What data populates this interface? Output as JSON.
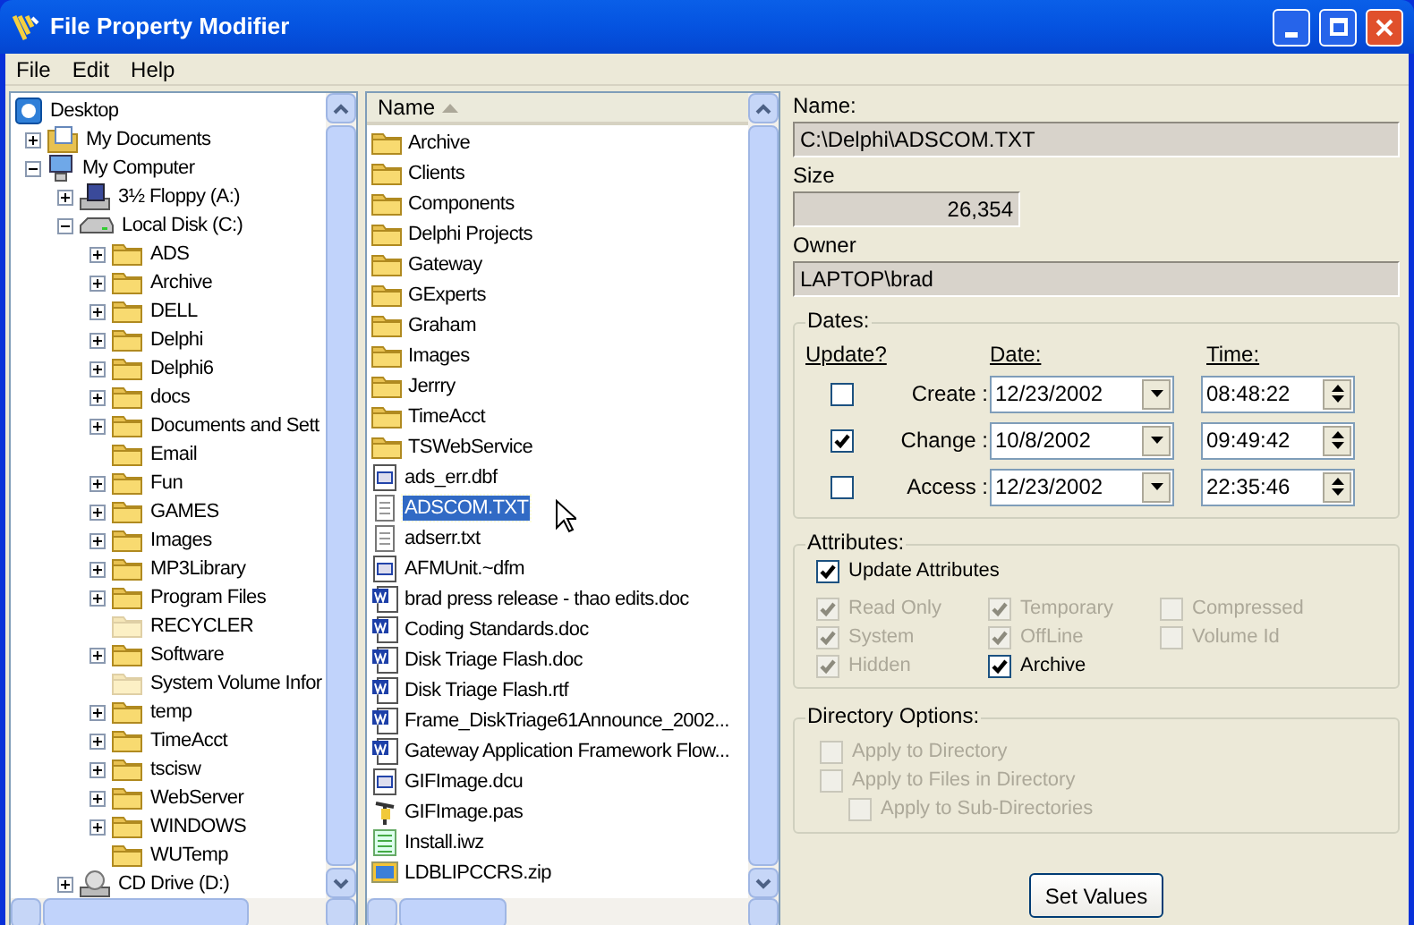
{
  "window": {
    "title": "File Property Modifier"
  },
  "menu": [
    "File",
    "Edit",
    "Help"
  ],
  "tree": [
    {
      "label": "Desktop",
      "kind": "desktop",
      "children": [
        {
          "label": "My Documents",
          "kind": "documents",
          "expanded": false
        },
        {
          "label": "My Computer",
          "kind": "computer",
          "expanded": true,
          "children": [
            {
              "label": "3½ Floppy (A:)",
              "kind": "floppy",
              "expanded": false
            },
            {
              "label": "Local Disk (C:)",
              "kind": "disk",
              "expanded": true,
              "children": [
                {
                  "label": "ADS",
                  "kind": "folder",
                  "expanded": false
                },
                {
                  "label": "Archive",
                  "kind": "folder",
                  "expanded": false
                },
                {
                  "label": "DELL",
                  "kind": "folder",
                  "expanded": false
                },
                {
                  "label": "Delphi",
                  "kind": "folder",
                  "expanded": false
                },
                {
                  "label": "Delphi6",
                  "kind": "folder",
                  "expanded": false
                },
                {
                  "label": "docs",
                  "kind": "folder",
                  "expanded": false
                },
                {
                  "label": "Documents and Sett",
                  "kind": "folder",
                  "expanded": false
                },
                {
                  "label": "Email",
                  "kind": "folder"
                },
                {
                  "label": "Fun",
                  "kind": "folder",
                  "expanded": false
                },
                {
                  "label": "GAMES",
                  "kind": "folder",
                  "expanded": false
                },
                {
                  "label": "Images",
                  "kind": "folder",
                  "expanded": false
                },
                {
                  "label": "MP3Library",
                  "kind": "folder",
                  "expanded": false
                },
                {
                  "label": "Program Files",
                  "kind": "folder",
                  "expanded": false
                },
                {
                  "label": "RECYCLER",
                  "kind": "hidden-folder"
                },
                {
                  "label": "Software",
                  "kind": "folder",
                  "expanded": false
                },
                {
                  "label": "System Volume Infor",
                  "kind": "hidden-folder"
                },
                {
                  "label": "temp",
                  "kind": "folder",
                  "expanded": false
                },
                {
                  "label": "TimeAcct",
                  "kind": "folder",
                  "expanded": false
                },
                {
                  "label": "tscisw",
                  "kind": "folder",
                  "expanded": false
                },
                {
                  "label": "WebServer",
                  "kind": "folder",
                  "expanded": false
                },
                {
                  "label": "WINDOWS",
                  "kind": "folder",
                  "expanded": false
                },
                {
                  "label": "WUTemp",
                  "kind": "folder"
                }
              ]
            },
            {
              "label": "CD Drive (D:)",
              "kind": "cd",
              "expanded": false
            }
          ]
        }
      ]
    }
  ],
  "file_list": {
    "column": "Name",
    "items": [
      {
        "name": "Archive",
        "kind": "folder",
        "selected": false
      },
      {
        "name": "Clients",
        "kind": "folder",
        "selected": false
      },
      {
        "name": "Components",
        "kind": "folder",
        "selected": false
      },
      {
        "name": "Delphi Projects",
        "kind": "folder",
        "selected": false
      },
      {
        "name": "Gateway",
        "kind": "folder",
        "selected": false
      },
      {
        "name": "GExperts",
        "kind": "folder",
        "selected": false
      },
      {
        "name": "Graham",
        "kind": "folder",
        "selected": false
      },
      {
        "name": "Images",
        "kind": "folder",
        "selected": false
      },
      {
        "name": "Jerrry",
        "kind": "folder",
        "selected": false
      },
      {
        "name": "TimeAcct",
        "kind": "folder",
        "selected": false
      },
      {
        "name": "TSWebService",
        "kind": "folder",
        "selected": false
      },
      {
        "name": "ads_err.dbf",
        "kind": "form",
        "selected": false
      },
      {
        "name": "ADSCOM.TXT",
        "kind": "text",
        "selected": true
      },
      {
        "name": "adserr.txt",
        "kind": "text",
        "selected": false
      },
      {
        "name": "AFMUnit.~dfm",
        "kind": "form",
        "selected": false
      },
      {
        "name": "brad press release - thao edits.doc",
        "kind": "word",
        "selected": false
      },
      {
        "name": "Coding Standards.doc",
        "kind": "word",
        "selected": false
      },
      {
        "name": "Disk Triage Flash.doc",
        "kind": "word",
        "selected": false
      },
      {
        "name": "Disk Triage Flash.rtf",
        "kind": "word",
        "selected": false
      },
      {
        "name": "Frame_DiskTriage61Announce_2002...",
        "kind": "word",
        "selected": false
      },
      {
        "name": "Gateway Application Framework Flow...",
        "kind": "word",
        "selected": false
      },
      {
        "name": "GIFImage.dcu",
        "kind": "form",
        "selected": false
      },
      {
        "name": "GIFImage.pas",
        "kind": "source",
        "selected": false
      },
      {
        "name": "Install.iwz",
        "kind": "setup",
        "selected": false
      },
      {
        "name": "LDBLIPCCRS.zip",
        "kind": "archive",
        "selected": false
      }
    ]
  },
  "properties": {
    "name": {
      "label": "Name:",
      "value": "C:\\Delphi\\ADSCOM.TXT"
    },
    "size": {
      "label": "Size",
      "value": "26,354"
    },
    "owner": {
      "label": "Owner",
      "value": "LAPTOP\\brad"
    },
    "dates": {
      "title": "Dates:",
      "headers": [
        "Update?",
        "Date:",
        "Time:"
      ],
      "rows": [
        {
          "label": "Create :",
          "checked": false,
          "date": "12/23/2002",
          "time": "08:48:22"
        },
        {
          "label": "Change :",
          "checked": true,
          "date": "10/8/2002",
          "time": "09:49:42"
        },
        {
          "label": "Access :",
          "checked": false,
          "date": "12/23/2002",
          "time": "22:35:46"
        }
      ]
    },
    "attributes": {
      "title": "Attributes:",
      "update": {
        "label": "Update Attributes",
        "checked": true,
        "disabled": false
      },
      "items": [
        {
          "label": "Read Only",
          "checked": true,
          "disabled": true
        },
        {
          "label": "System",
          "checked": true,
          "disabled": true
        },
        {
          "label": "Hidden",
          "checked": true,
          "disabled": true
        },
        {
          "label": "Temporary",
          "checked": true,
          "disabled": true
        },
        {
          "label": "OffLine",
          "checked": true,
          "disabled": true
        },
        {
          "label": "Archive",
          "checked": true,
          "disabled": false
        },
        {
          "label": "Compressed",
          "checked": false,
          "disabled": true
        },
        {
          "label": "Volume Id",
          "checked": false,
          "disabled": true
        }
      ]
    },
    "directory_options": {
      "title": "Directory Options:",
      "items": [
        {
          "label": "Apply to Directory",
          "checked": false,
          "disabled": true
        },
        {
          "label": "Apply to Files in Directory",
          "checked": false,
          "disabled": true,
          "children": [
            {
              "label": "Apply to Sub-Directories",
              "checked": false,
              "disabled": true
            }
          ]
        }
      ]
    },
    "button": "Set Values"
  }
}
